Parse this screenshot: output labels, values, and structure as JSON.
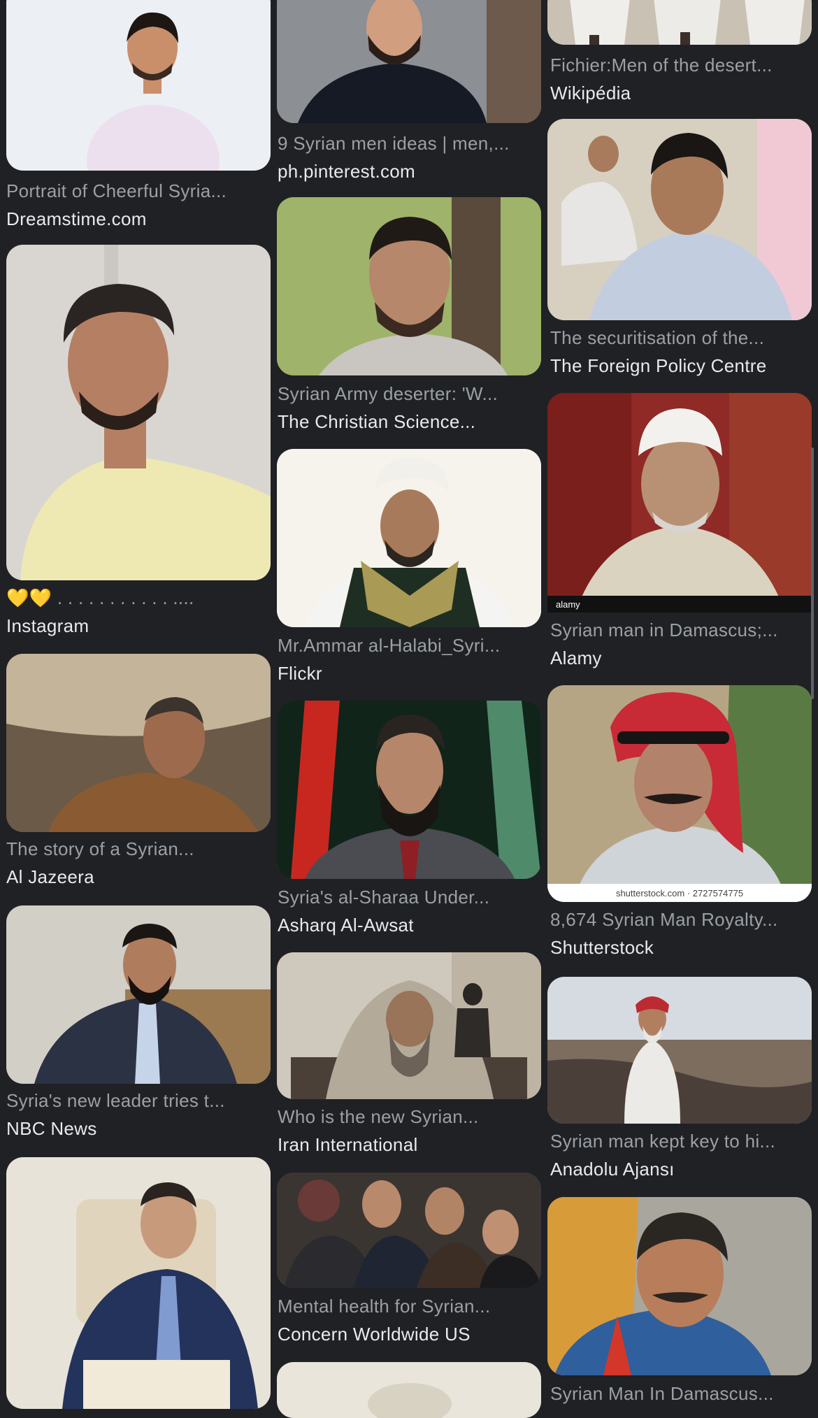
{
  "results": [
    {
      "caption": "Portrait of Cheerful Syria...",
      "source": "Dreamstime.com",
      "image": "smiling-man-white-shirt-photo"
    },
    {
      "caption": "💛💛 . . . . . . . . . . . ....",
      "source": "Instagram",
      "image": "man-yellow-vneck-photo"
    },
    {
      "caption": "The story of a Syrian...",
      "source": "Al Jazeera",
      "image": "man-in-tent-photo"
    },
    {
      "caption": "Syria's new leader tries t...",
      "source": "NBC News",
      "image": "bearded-man-suit-seated-photo"
    },
    {
      "caption": "",
      "source": "",
      "image": "man-at-podium-photo"
    },
    {
      "caption": "9 Syrian men ideas | men,...",
      "source": "ph.pinterest.com",
      "image": "bearded-man-street-photo"
    },
    {
      "caption": "Syrian Army deserter: 'W...",
      "source": "The Christian Science...",
      "image": "man-outdoors-tree-photo"
    },
    {
      "caption": "Mr.Ammar al-Halabi_Syri...",
      "source": "Flickr",
      "image": "man-white-turban-photo"
    },
    {
      "caption": "Syria's al-Sharaa Under...",
      "source": "Asharq Al-Awsat",
      "image": "bearded-man-flags-photo"
    },
    {
      "caption": "Who is the new Syrian...",
      "source": "Iran International",
      "image": "man-hooded-mosque-photo"
    },
    {
      "caption": "Mental health for Syrian...",
      "source": "Concern Worldwide US",
      "image": "group-of-men-photo"
    },
    {
      "caption": "",
      "source": "",
      "image": "partial-photo"
    },
    {
      "caption": "Fichier:Men of the desert...",
      "source": "Wikipédia",
      "image": "men-in-robes-photo"
    },
    {
      "caption": "The securitisation of the...",
      "source": "The Foreign Policy Centre",
      "image": "man-in-crowd-photo"
    },
    {
      "caption": "Syrian man in Damascus;...",
      "source": "Alamy",
      "image": "elderly-man-white-cap-photo",
      "watermark": "alamy"
    },
    {
      "caption": "8,674 Syrian Man Royalty...",
      "source": "Shutterstock",
      "image": "man-keffiyeh-photo",
      "watermark": "shutterstock.com · 2727574775"
    },
    {
      "caption": "Syrian man kept key to hi...",
      "source": "Anadolu Ajansı",
      "image": "man-in-ruins-photo"
    },
    {
      "caption": "Syrian Man In Damascus...",
      "source": "",
      "image": "smiling-man-mustache-photo"
    }
  ],
  "colors": {
    "background": "#202124",
    "caption": "#9aa0a6",
    "source": "#e8eaed"
  }
}
